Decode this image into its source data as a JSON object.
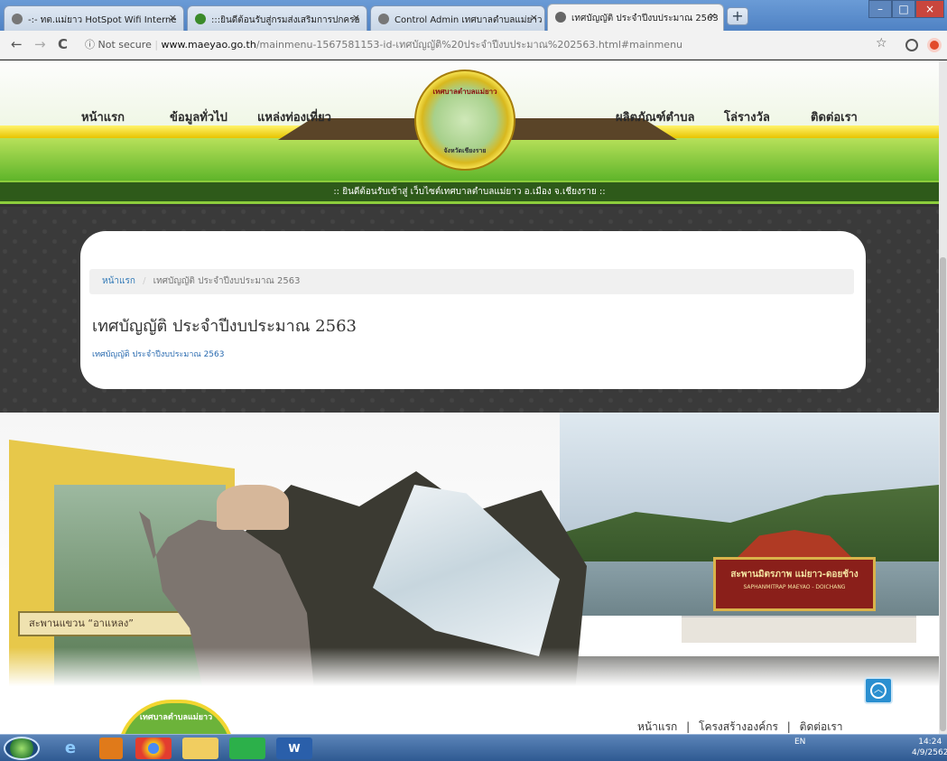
{
  "browser": {
    "tabs": [
      {
        "title": "-:- ทต.แม่ยาว HotSpot Wifi Interne",
        "icon": "globe-icon",
        "active": false
      },
      {
        "title": ":::ยินดีต้อนรับสู่กรมส่งเสริมการปกครอ",
        "icon": "dopa-icon",
        "active": false
      },
      {
        "title": "Control Admin เทศบาลตำบลแม่ยาว",
        "icon": "globe-icon",
        "active": false
      },
      {
        "title": "เทศบัญญัติ ประจำปีงบประมาณ 2563",
        "icon": "globe-icon",
        "active": true
      }
    ],
    "close_glyph": "×",
    "new_tab_glyph": "+",
    "back_glyph": "←",
    "forward_glyph": "→",
    "reload_glyph": "C",
    "security_label": "ⓘ Not secure",
    "url_host": "www.maeyao.go.th",
    "url_path": "/mainmenu-1567581153-id-เทศบัญญัติ%20ประจำปีงบประมาณ%202563.html#mainmenu",
    "star_glyph": "☆",
    "window_min": "–",
    "window_max": "□",
    "window_close": "×"
  },
  "site": {
    "nav_left": [
      "หน้าแรก",
      "ข้อมูลทั่วไป",
      "แหล่งท่องเที่ยว"
    ],
    "nav_right": [
      "ผลิตภัณฑ์ตำบล",
      "โล่รางวัล",
      "ติดต่อเรา"
    ],
    "seal_top": "เทศบาลตำบลแม่ยาว",
    "seal_bottom": "จังหวัดเชียงราย",
    "welcome": ":: ยินดีต้อนรับเข้าสู่ เว็บไซต์เทศบาลตำบลแม่ยาว อ.เมือง จ.เชียงราย ::"
  },
  "content": {
    "breadcrumb_home": "หน้าแรก",
    "breadcrumb_sep": "/",
    "breadcrumb_current": "เทศบัญญัติ ประจำปีงบประมาณ 2563",
    "title": "เทศบัญญัติ ประจำปีงบประมาณ 2563",
    "link": "เทศบัญญัติ ประจำปีงบประมาณ 2563"
  },
  "scenery": {
    "bridge_sign": "สะพานแขวน “อาแหลง”",
    "bridge_sign2": "สะพานมิตรภาพ แม่ยาว-ดอยช้าง",
    "bridge_sign3": "SAPHANMITRAP MAEYAO - DOICHANG",
    "badge": "เทศบาลตำบลแม่ยาว"
  },
  "footer": {
    "links": [
      "หน้าแรก",
      "โครงสร้างองค์กร",
      "ติดต่อเรา"
    ],
    "sep": "|",
    "to_top_glyph": "︿"
  },
  "taskbar": {
    "apps": [
      "ie-icon",
      "media-player-icon",
      "chrome-icon",
      "folder-icon",
      "line-icon",
      "word-icon"
    ],
    "lang": "EN",
    "time": "14:24",
    "date": "4/9/2562"
  }
}
